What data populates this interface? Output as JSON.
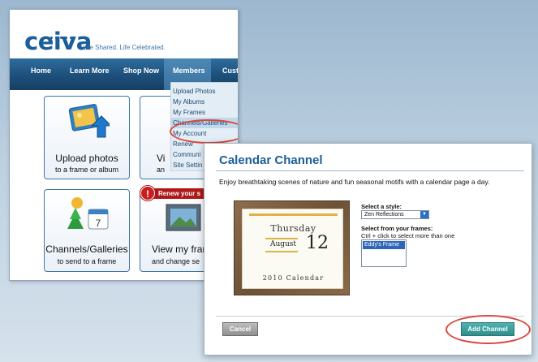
{
  "site": {
    "logo": "ceiva",
    "tagline": "Life Shared.  Life Celebrated.",
    "nav": {
      "home": "Home",
      "learn_more": "Learn More",
      "shop_now": "Shop Now",
      "members": "Members",
      "customer_partial": "Cust"
    },
    "members_menu": [
      "Upload Photos",
      "My Albums",
      "My Frames",
      "Channels/Galleries",
      "My Account",
      "Renew",
      "Communi",
      "Site Settin"
    ],
    "tiles": {
      "upload": {
        "title": "Upload photos",
        "subtitle": "to a frame or album"
      },
      "view_partial_top": {
        "title": "Vi",
        "subtitle": "an"
      },
      "channels": {
        "title": "Channels/Galleries",
        "subtitle": "to send to a frame"
      },
      "view_frame": {
        "title": "View my fran",
        "subtitle": "and change se"
      }
    },
    "renew_badge": {
      "icon": "!",
      "label": "Renew your s"
    },
    "calendar_icon_day": "7"
  },
  "dialog": {
    "title": "Calendar Channel",
    "description": "Enjoy breathtaking scenes of nature and fun seasonal motifs with a calendar page a day.",
    "calendar_preview": {
      "weekday": "Thursday",
      "month": "August",
      "day": "12",
      "year_line": "2010 Calendar"
    },
    "style": {
      "label": "Select a style:",
      "value": "Zen Reflections"
    },
    "frames": {
      "label": "Select from your frames:",
      "hint": "Ctrl + click to select more than one",
      "options": [
        "Eddy's Frame"
      ]
    },
    "buttons": {
      "cancel": "Cancel",
      "add": "Add Channel"
    }
  },
  "colors": {
    "brand_blue": "#1b5e9a",
    "nav_dark": "#1d4f7b",
    "highlight_red": "#d9473c",
    "add_button_teal": "#3aa3a0",
    "renew_red": "#b01818"
  }
}
